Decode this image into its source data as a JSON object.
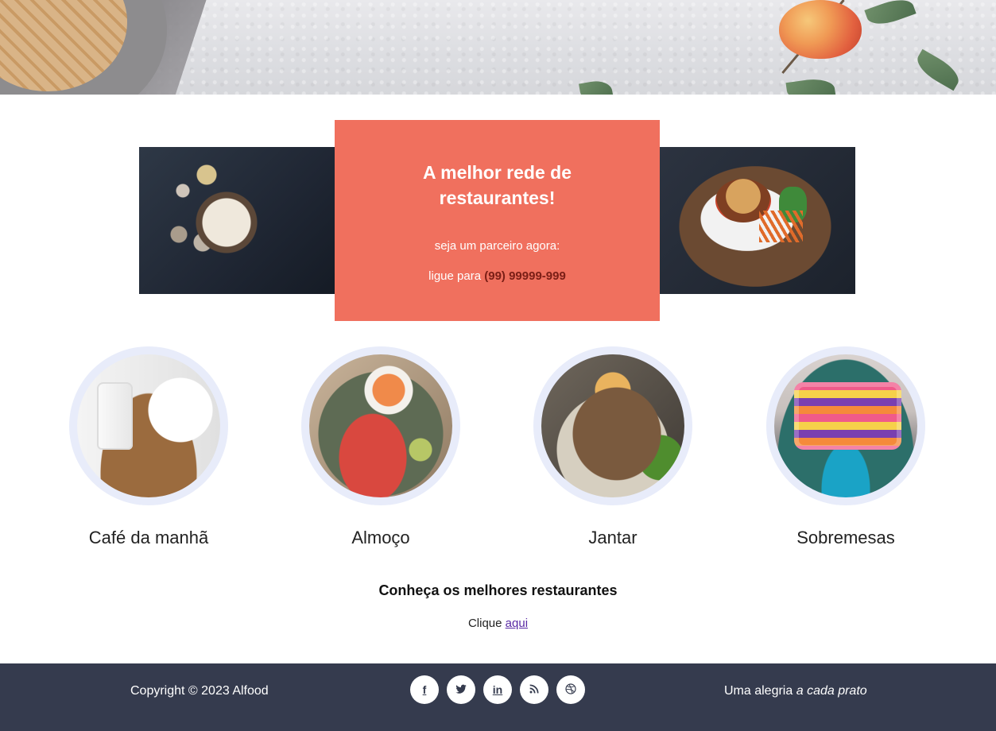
{
  "promo": {
    "title": "A melhor rede de restaurantes!",
    "subtitle": "seja um parceiro agora:",
    "call_prefix": "ligue para",
    "phone": "(99) 99999-999"
  },
  "categories": [
    {
      "label": "Café da manhã"
    },
    {
      "label": "Almoço"
    },
    {
      "label": "Jantar"
    },
    {
      "label": "Sobremesas"
    }
  ],
  "know": {
    "title": "Conheça os melhores restaurantes",
    "prefix": "Clique",
    "link": "aqui"
  },
  "footer": {
    "copyright": "Copyright © 2023 Alfood",
    "tagline_plain": "Uma alegria",
    "tagline_italic": "a cada prato",
    "social": [
      {
        "icon": "facebook-icon",
        "glyph": "f"
      },
      {
        "icon": "twitter-icon"
      },
      {
        "icon": "linkedin-icon",
        "glyph": "in"
      },
      {
        "icon": "rss-icon"
      },
      {
        "icon": "dribbble-icon"
      }
    ]
  },
  "colors": {
    "promo_bg": "#f0705e",
    "phone": "#7a1e16",
    "footer_bg": "#353b4e",
    "ring": "#e8ecfa"
  }
}
